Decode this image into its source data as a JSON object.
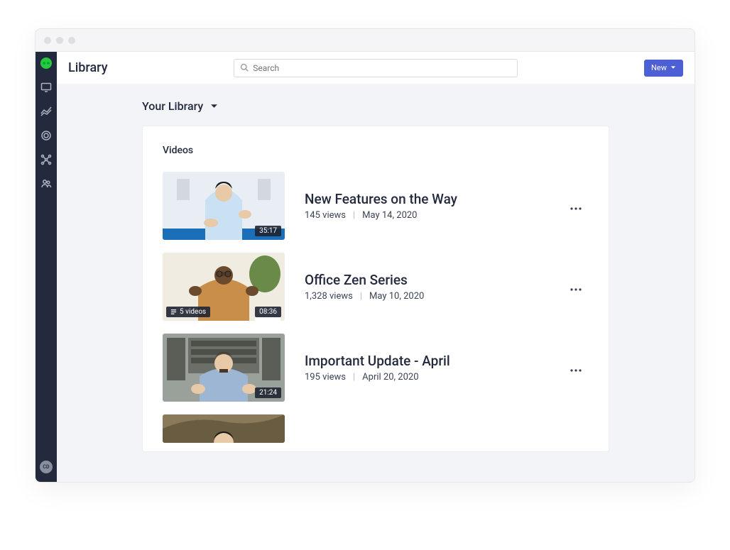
{
  "header": {
    "page_title": "Library",
    "search_placeholder": "Search",
    "new_button_label": "New"
  },
  "sidebar": {
    "avatar_initials": "CD"
  },
  "library": {
    "dropdown_label": "Your Library",
    "section_title": "Videos"
  },
  "videos": [
    {
      "title": "New Features on the Way",
      "views": "145 views",
      "date": "May 14, 2020",
      "duration": "35:17",
      "playlist": null
    },
    {
      "title": "Office Zen Series",
      "views": "1,328 views",
      "date": "May 10, 2020",
      "duration": "08:36",
      "playlist": "5 videos"
    },
    {
      "title": "Important Update - April",
      "views": "195 views",
      "date": "April 20, 2020",
      "duration": "21:24",
      "playlist": null
    }
  ]
}
